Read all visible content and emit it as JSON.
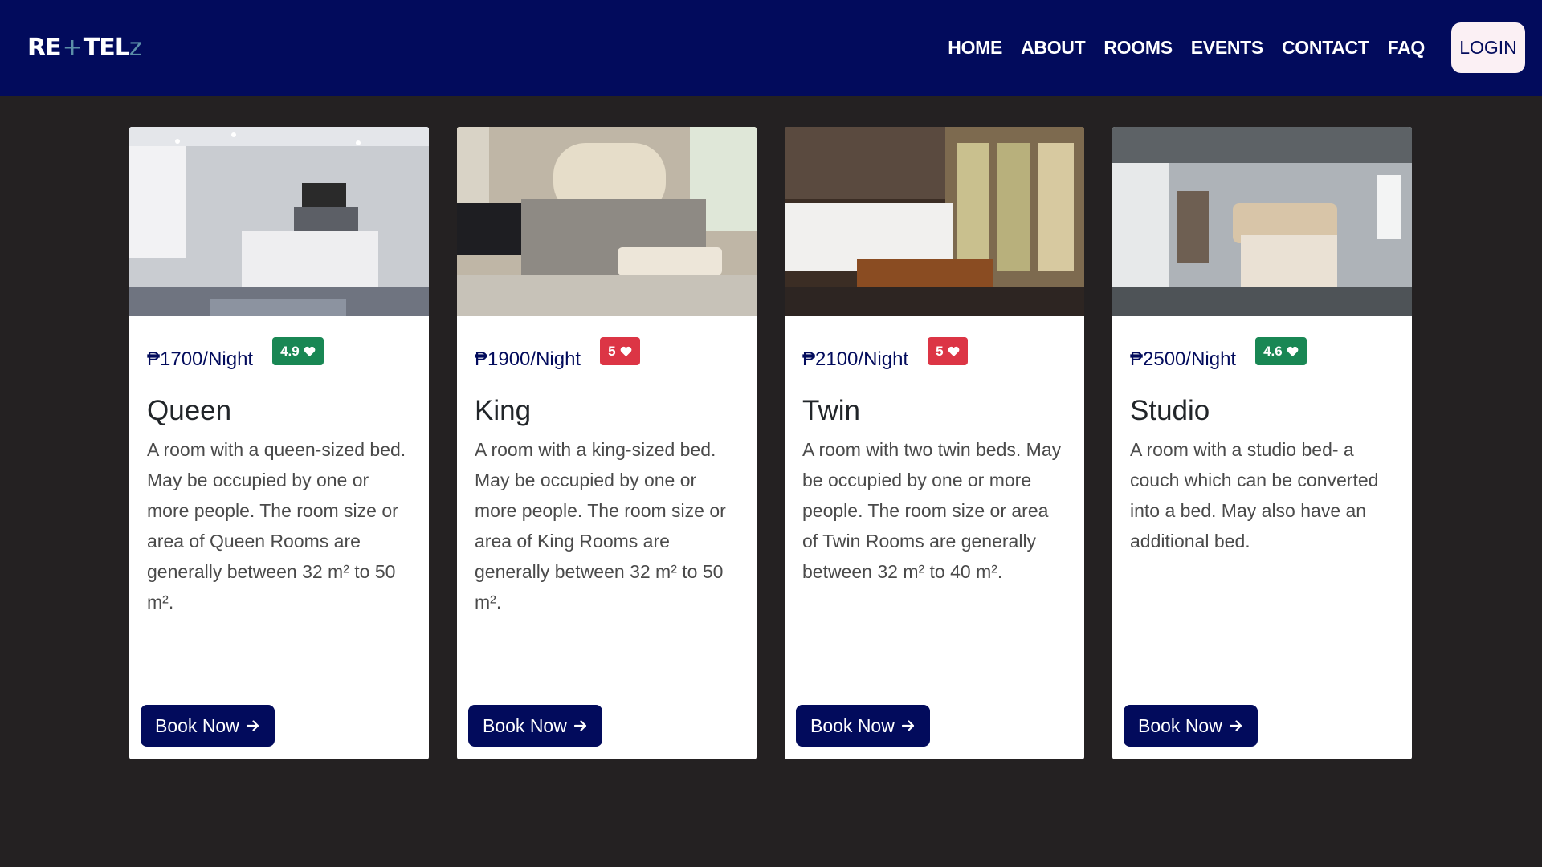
{
  "nav": {
    "brand_re": "RE",
    "brand_plus": "+",
    "brand_tel": "TEL",
    "brand_z": "z",
    "links": [
      "HOME",
      "ABOUT",
      "ROOMS",
      "EVENTS",
      "CONTACT",
      "FAQ"
    ],
    "login": "LOGIN"
  },
  "colors": {
    "navbar": "#020b5c",
    "page_background": "#242122",
    "rating_green": "#198754",
    "rating_red": "#dc3545"
  },
  "rooms": [
    {
      "price": "₱1700/Night",
      "rating": "4.9",
      "rating_color": "green",
      "title": "Queen",
      "description": "A room with a queen-sized bed. May be occupied by one or more people. The room size or area of Queen Rooms are generally between 32 m² to 50 m².",
      "button": "Book Now",
      "image": "bedroom-photo"
    },
    {
      "price": "₱1900/Night",
      "rating": "5",
      "rating_color": "red",
      "title": "King",
      "description": "A room with a king-sized bed. May be occupied by one or more people. The room size or area of King Rooms are generally between 32 m² to 50 m².",
      "button": "Book Now",
      "image": "bedroom-photo"
    },
    {
      "price": "₱2100/Night",
      "rating": "5",
      "rating_color": "red",
      "title": "Twin",
      "description": "A room with two twin beds. May be occupied by one or more people. The room size or area of Twin Rooms are generally between 32 m² to 40 m².",
      "button": "Book Now",
      "image": "bedroom-photo"
    },
    {
      "price": "₱2500/Night",
      "rating": "4.6",
      "rating_color": "green",
      "title": "Studio",
      "description": "A room with a studio bed- a couch which can be converted into a bed. May also have an additional bed.",
      "button": "Book Now",
      "image": "bedroom-photo"
    }
  ]
}
